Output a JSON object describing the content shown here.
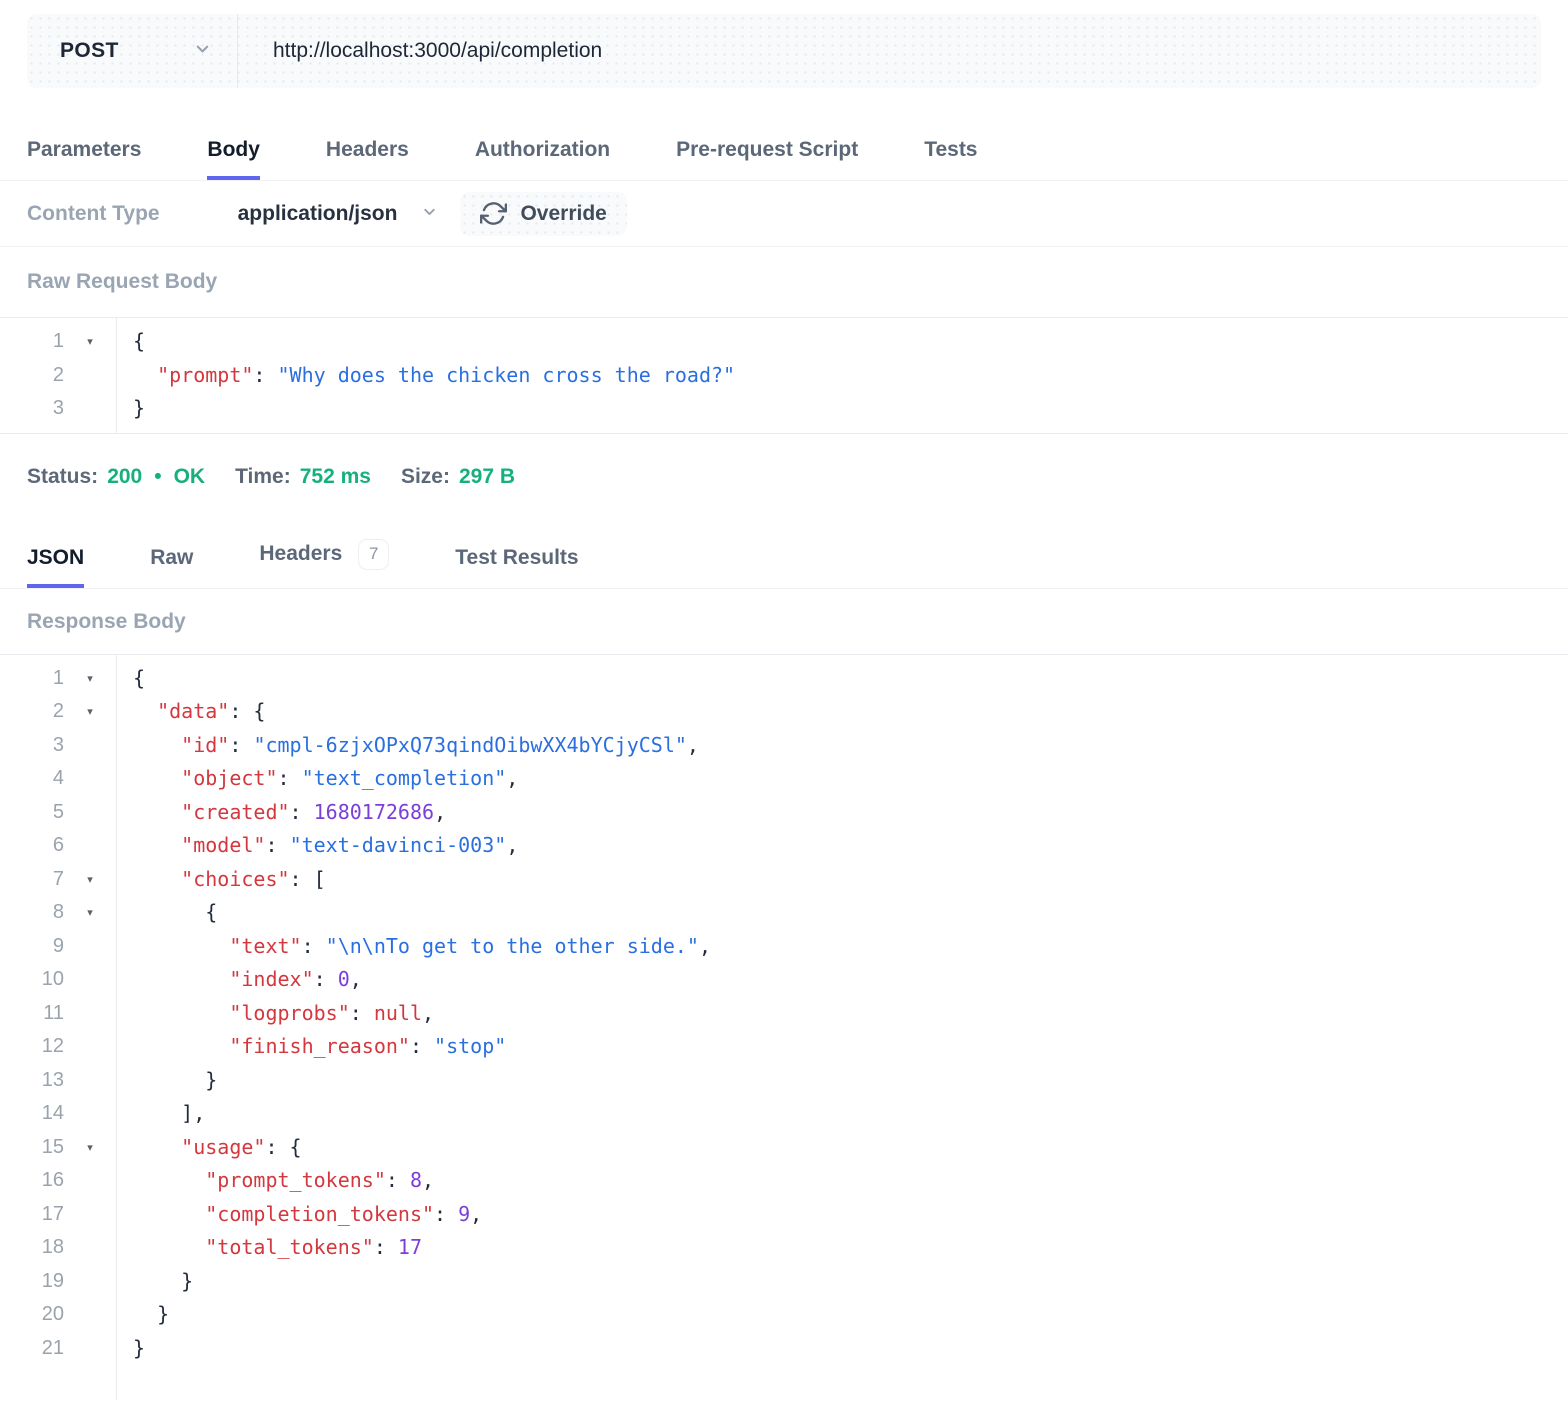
{
  "request_bar": {
    "method": "POST",
    "url": "http://localhost:3000/api/completion"
  },
  "request_tabs": [
    {
      "label": "Parameters",
      "active": false
    },
    {
      "label": "Body",
      "active": true
    },
    {
      "label": "Headers",
      "active": false
    },
    {
      "label": "Authorization",
      "active": false
    },
    {
      "label": "Pre-request Script",
      "active": false
    },
    {
      "label": "Tests",
      "active": false
    }
  ],
  "content_type": {
    "label": "Content Type",
    "value": "application/json",
    "override_label": "Override"
  },
  "request_body": {
    "section_label": "Raw Request Body",
    "lines": [
      {
        "n": "1",
        "f": true,
        "s": [
          [
            "p",
            "{"
          ]
        ]
      },
      {
        "n": "2",
        "f": false,
        "s": [
          [
            "p",
            "  "
          ],
          [
            "k",
            "\"prompt\""
          ],
          [
            "p",
            ": "
          ],
          [
            "s",
            "\"Why does the chicken cross the road?\""
          ]
        ]
      },
      {
        "n": "3",
        "f": false,
        "s": [
          [
            "p",
            "}"
          ]
        ]
      }
    ]
  },
  "status_bar": {
    "status_label": "Status:",
    "status_code": "200",
    "separator": "•",
    "status_text": "OK",
    "time_label": "Time:",
    "time_value": "752 ms",
    "size_label": "Size:",
    "size_value": "297 B"
  },
  "response_tabs": [
    {
      "label": "JSON",
      "active": true
    },
    {
      "label": "Raw",
      "active": false
    },
    {
      "label": "Headers",
      "active": false,
      "badge": "7"
    },
    {
      "label": "Test Results",
      "active": false
    }
  ],
  "response_body": {
    "section_label": "Response Body",
    "lines": [
      {
        "n": "1",
        "f": true,
        "s": [
          [
            "p",
            "{"
          ]
        ]
      },
      {
        "n": "2",
        "f": true,
        "s": [
          [
            "p",
            "  "
          ],
          [
            "k",
            "\"data\""
          ],
          [
            "p",
            ": {"
          ]
        ]
      },
      {
        "n": "3",
        "f": false,
        "s": [
          [
            "p",
            "    "
          ],
          [
            "k",
            "\"id\""
          ],
          [
            "p",
            ": "
          ],
          [
            "s",
            "\"cmpl-6zjxOPxQ73qindOibwXX4bYCjyCSl\""
          ],
          [
            "p",
            ","
          ]
        ]
      },
      {
        "n": "4",
        "f": false,
        "s": [
          [
            "p",
            "    "
          ],
          [
            "k",
            "\"object\""
          ],
          [
            "p",
            ": "
          ],
          [
            "s",
            "\"text_completion\""
          ],
          [
            "p",
            ","
          ]
        ]
      },
      {
        "n": "5",
        "f": false,
        "s": [
          [
            "p",
            "    "
          ],
          [
            "k",
            "\"created\""
          ],
          [
            "p",
            ": "
          ],
          [
            "n",
            "1680172686"
          ],
          [
            "p",
            ","
          ]
        ]
      },
      {
        "n": "6",
        "f": false,
        "s": [
          [
            "p",
            "    "
          ],
          [
            "k",
            "\"model\""
          ],
          [
            "p",
            ": "
          ],
          [
            "s",
            "\"text-davinci-003\""
          ],
          [
            "p",
            ","
          ]
        ]
      },
      {
        "n": "7",
        "f": true,
        "s": [
          [
            "p",
            "    "
          ],
          [
            "k",
            "\"choices\""
          ],
          [
            "p",
            ": ["
          ]
        ]
      },
      {
        "n": "8",
        "f": true,
        "s": [
          [
            "p",
            "      {"
          ]
        ]
      },
      {
        "n": "9",
        "f": false,
        "s": [
          [
            "p",
            "        "
          ],
          [
            "k",
            "\"text\""
          ],
          [
            "p",
            ": "
          ],
          [
            "s",
            "\"\\n\\nTo get to the other side.\""
          ],
          [
            "p",
            ","
          ]
        ]
      },
      {
        "n": "10",
        "f": false,
        "s": [
          [
            "p",
            "        "
          ],
          [
            "k",
            "\"index\""
          ],
          [
            "p",
            ": "
          ],
          [
            "n",
            "0"
          ],
          [
            "p",
            ","
          ]
        ]
      },
      {
        "n": "11",
        "f": false,
        "s": [
          [
            "p",
            "        "
          ],
          [
            "k",
            "\"logprobs\""
          ],
          [
            "p",
            ": "
          ],
          [
            "a",
            "null"
          ],
          [
            "p",
            ","
          ]
        ]
      },
      {
        "n": "12",
        "f": false,
        "s": [
          [
            "p",
            "        "
          ],
          [
            "k",
            "\"finish_reason\""
          ],
          [
            "p",
            ": "
          ],
          [
            "s",
            "\"stop\""
          ]
        ]
      },
      {
        "n": "13",
        "f": false,
        "s": [
          [
            "p",
            "      }"
          ]
        ]
      },
      {
        "n": "14",
        "f": false,
        "s": [
          [
            "p",
            "    ],"
          ]
        ]
      },
      {
        "n": "15",
        "f": true,
        "s": [
          [
            "p",
            "    "
          ],
          [
            "k",
            "\"usage\""
          ],
          [
            "p",
            ": {"
          ]
        ]
      },
      {
        "n": "16",
        "f": false,
        "s": [
          [
            "p",
            "      "
          ],
          [
            "k",
            "\"prompt_tokens\""
          ],
          [
            "p",
            ": "
          ],
          [
            "n",
            "8"
          ],
          [
            "p",
            ","
          ]
        ]
      },
      {
        "n": "17",
        "f": false,
        "s": [
          [
            "p",
            "      "
          ],
          [
            "k",
            "\"completion_tokens\""
          ],
          [
            "p",
            ": "
          ],
          [
            "n",
            "9"
          ],
          [
            "p",
            ","
          ]
        ]
      },
      {
        "n": "18",
        "f": false,
        "s": [
          [
            "p",
            "      "
          ],
          [
            "k",
            "\"total_tokens\""
          ],
          [
            "p",
            ": "
          ],
          [
            "n",
            "17"
          ]
        ]
      },
      {
        "n": "19",
        "f": false,
        "s": [
          [
            "p",
            "    }"
          ]
        ]
      },
      {
        "n": "20",
        "f": false,
        "s": [
          [
            "p",
            "  }"
          ]
        ]
      },
      {
        "n": "21",
        "f": false,
        "s": [
          [
            "p",
            "}"
          ]
        ]
      }
    ]
  },
  "icons": {
    "method_dropdown": "chevron-down",
    "content_type_dropdown": "chevron-down",
    "override_button": "refresh-sync",
    "code_fold": "triangle-down"
  },
  "colors": {
    "accent_underline": "#6065ef",
    "success_green": "#16b07e",
    "json_key_red": "#d2383e",
    "json_string_blue": "#2a6fe0",
    "json_number_purple": "#7b3fd9",
    "json_null_red": "#d2383e"
  }
}
